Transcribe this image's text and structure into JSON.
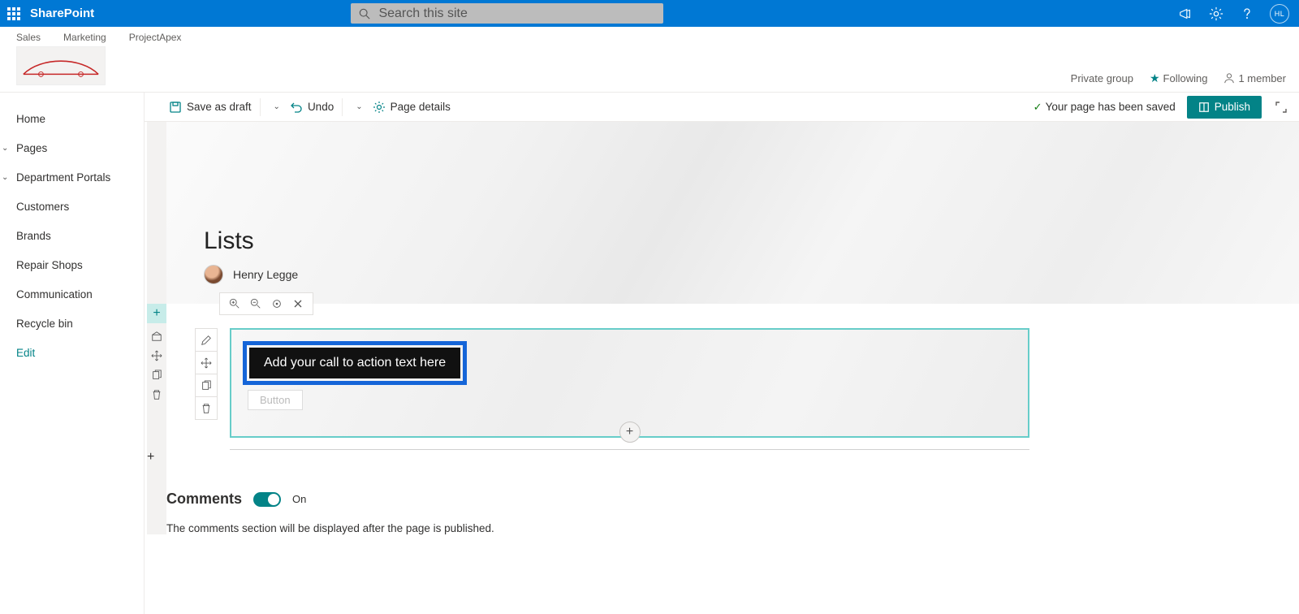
{
  "suite": {
    "brand": "SharePoint",
    "search_placeholder": "Search this site",
    "avatar_initials": "HL"
  },
  "site": {
    "nav": [
      "Sales",
      "Marketing",
      "ProjectApex"
    ],
    "info": {
      "privacy": "Private group",
      "following": "Following",
      "members": "1 member"
    }
  },
  "cmdbar": {
    "save": "Save as draft",
    "undo": "Undo",
    "page_details": "Page details",
    "saved_msg": "Your page has been saved",
    "publish": "Publish"
  },
  "leftnav": {
    "items": [
      {
        "label": "Home",
        "caret": false
      },
      {
        "label": "Pages",
        "caret": true
      },
      {
        "label": "Department Portals",
        "caret": true
      },
      {
        "label": "Customers",
        "caret": false
      },
      {
        "label": "Brands",
        "caret": false
      },
      {
        "label": "Repair Shops",
        "caret": false
      },
      {
        "label": "Communication",
        "caret": false
      },
      {
        "label": "Recycle bin",
        "caret": false
      }
    ],
    "edit": "Edit"
  },
  "page": {
    "title": "Lists",
    "author": "Henry Legge"
  },
  "cta": {
    "placeholder": "Add your call to action text here",
    "button": "Button"
  },
  "comments": {
    "title": "Comments",
    "state": "On",
    "note": "The comments section will be displayed after the page is published."
  }
}
